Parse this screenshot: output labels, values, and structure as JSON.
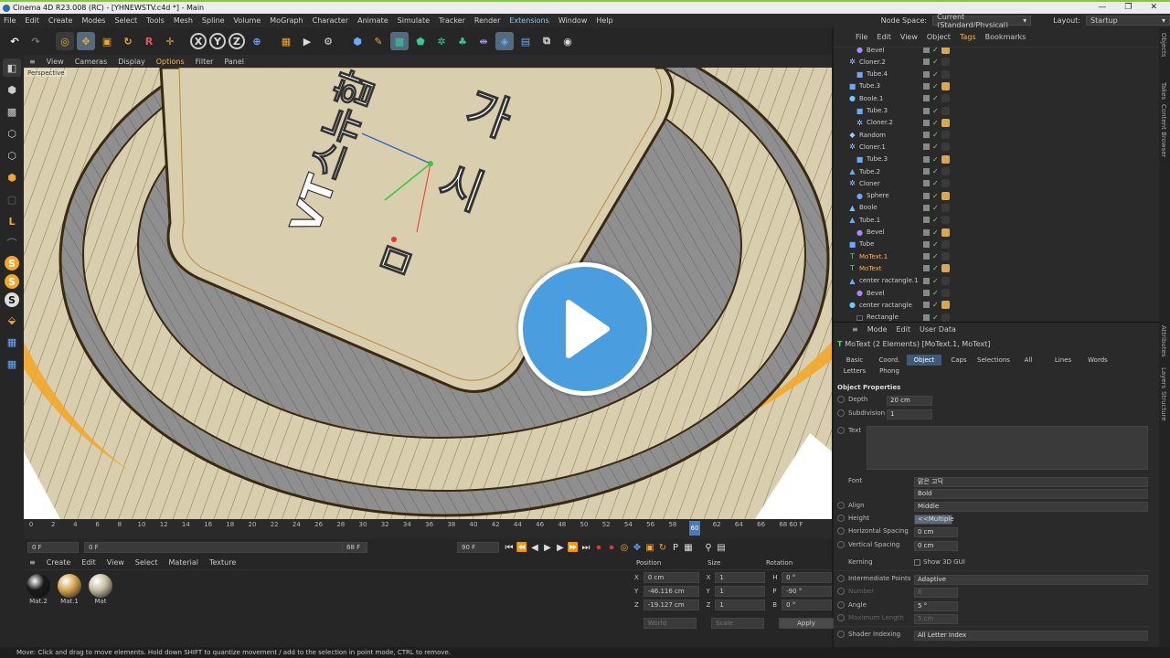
{
  "window": {
    "title": "Cinema 4D R23.008 (RC) - [YHNEWSTV.c4d *] - Main",
    "controls": [
      "—",
      "❐",
      "✕"
    ]
  },
  "menu": [
    "File",
    "Edit",
    "Create",
    "Modes",
    "Select",
    "Tools",
    "Mesh",
    "Spline",
    "Volume",
    "MoGraph",
    "Character",
    "Animate",
    "Simulate",
    "Tracker",
    "Render",
    "Extensions",
    "Window",
    "Help"
  ],
  "header_right": {
    "node_space_label": "Node Space:",
    "node_space_value": "Current (Standard/Physical)",
    "layout_label": "Layout:",
    "layout_value": "Startup"
  },
  "viewport": {
    "menu": [
      "View",
      "Cameras",
      "Display",
      "Options",
      "Filter",
      "Panel"
    ],
    "label": "Perspective"
  },
  "timeline": {
    "ticks": [
      "0",
      "2",
      "4",
      "6",
      "8",
      "10",
      "12",
      "14",
      "16",
      "18",
      "20",
      "22",
      "24",
      "26",
      "28",
      "30",
      "32",
      "34",
      "36",
      "38",
      "40",
      "42",
      "44",
      "46",
      "48",
      "50",
      "52",
      "54",
      "56",
      "58",
      "60",
      "62",
      "64",
      "66",
      "68"
    ],
    "current": "60",
    "end_label": "60 F"
  },
  "transport": {
    "start": "0 F",
    "start2": "0 F",
    "end_field": "68 F",
    "end2": "90 F"
  },
  "materials": {
    "menu": [
      "Create",
      "Edit",
      "View",
      "Select",
      "Material",
      "Texture"
    ],
    "items": [
      {
        "name": "Mat.2",
        "color": "#1a1a1a"
      },
      {
        "name": "Mat.1",
        "color": "#d8a850"
      },
      {
        "name": "Mat",
        "color": "#c8c0a0"
      }
    ]
  },
  "coords": {
    "headers": [
      "Position",
      "Size",
      "Rotation"
    ],
    "rows": [
      {
        "axis": "X",
        "pos": "0 cm",
        "size_axis": "X",
        "size": "1",
        "rot_axis": "H",
        "rot": "0 °"
      },
      {
        "axis": "Y",
        "pos": "-46.116 cm",
        "size_axis": "Y",
        "size": "1",
        "rot_axis": "P",
        "rot": "-90 °"
      },
      {
        "axis": "Z",
        "pos": "-19.127 cm",
        "size_axis": "Z",
        "size": "1",
        "rot_axis": "B",
        "rot": "0 °"
      }
    ],
    "mode1": "World",
    "mode2": "Scale",
    "apply": "Apply"
  },
  "status": "Move: Click and drag to move elements. Hold down SHIFT to quantize movement / add to the selection in point mode, CTRL to remove.",
  "object_manager": {
    "menu": [
      "File",
      "Edit",
      "View",
      "Object",
      "Tags",
      "Bookmarks"
    ],
    "rows": [
      {
        "name": "Bevel",
        "indent": 2,
        "icon": "●",
        "color": "#a8f"
      },
      {
        "name": "Cloner.2",
        "indent": 1,
        "icon": "✲",
        "color": "#9cf"
      },
      {
        "name": "Tube.4",
        "indent": 2,
        "icon": "■",
        "color": "#6af"
      },
      {
        "name": "Tube.3",
        "indent": 1,
        "icon": "■",
        "color": "#6af"
      },
      {
        "name": "Boole.1",
        "indent": 1,
        "icon": "●",
        "color": "#6cf"
      },
      {
        "name": "Tube.3",
        "indent": 2,
        "icon": "■",
        "color": "#6af"
      },
      {
        "name": "Cloner.2",
        "indent": 2,
        "icon": "✲",
        "color": "#9cf"
      },
      {
        "name": "Random",
        "indent": 1,
        "icon": "◆",
        "color": "#9cf"
      },
      {
        "name": "Cloner.1",
        "indent": 1,
        "icon": "✲",
        "color": "#9cf"
      },
      {
        "name": "Tube.3",
        "indent": 2,
        "icon": "■",
        "color": "#6af"
      },
      {
        "name": "Tube.2",
        "indent": 1,
        "icon": "▲",
        "color": "#6af"
      },
      {
        "name": "Cloner",
        "indent": 1,
        "icon": "✲",
        "color": "#9cf"
      },
      {
        "name": "Sphere",
        "indent": 2,
        "icon": "●",
        "color": "#6af"
      },
      {
        "name": "Boole",
        "indent": 1,
        "icon": "▲",
        "color": "#6cf"
      },
      {
        "name": "Tube.1",
        "indent": 1,
        "icon": "▲",
        "color": "#6af"
      },
      {
        "name": "Bevel",
        "indent": 2,
        "icon": "●",
        "color": "#a8f"
      },
      {
        "name": "Tube",
        "indent": 1,
        "icon": "■",
        "color": "#6af"
      },
      {
        "name": "MoText.1",
        "indent": 1,
        "icon": "T",
        "color": "#6c6",
        "sel": true
      },
      {
        "name": "MoText",
        "indent": 1,
        "icon": "T",
        "color": "#6c6",
        "sel": true
      },
      {
        "name": "center ractangle.1",
        "indent": 1,
        "icon": "▲",
        "color": "#6af"
      },
      {
        "name": "Bevel",
        "indent": 2,
        "icon": "●",
        "color": "#a8f"
      },
      {
        "name": "center ractangle",
        "indent": 1,
        "icon": "●",
        "color": "#6cf"
      },
      {
        "name": "Rectangle",
        "indent": 2,
        "icon": "□",
        "color": "#aaa"
      }
    ]
  },
  "attributes": {
    "menu": [
      "Mode",
      "Edit",
      "User Data"
    ],
    "title": "MoText (2 Elements) [MoText.1, MoText]",
    "tabs": [
      "Basic",
      "Coord.",
      "Object",
      "Caps",
      "Selections",
      "All",
      "Lines",
      "Words",
      "Letters",
      "Phong"
    ],
    "active_tab": "Object",
    "section": "Object Properties",
    "depth_label": "Depth",
    "depth": "20 cm",
    "subdiv_label": "Subdivision",
    "subdiv": "1",
    "text_label": "Text",
    "font_label": "Font",
    "font": "맑은 고딕",
    "font_style": "Bold",
    "align_label": "Align",
    "align": "Middle",
    "height_label": "Height",
    "height": "<<Multiple",
    "hspace_label": "Horizontal Spacing",
    "hspace": "0 cm",
    "vspace_label": "Vertical Spacing",
    "vspace": "0 cm",
    "kerning_label": "Kerning",
    "show3d": "Show 3D GUI",
    "interp_label": "Intermediate Points",
    "interp": "Adaptive",
    "number_label": "Number",
    "number": "8",
    "angle_label": "Angle",
    "angle": "5 °",
    "maxlen_label": "Maximum Length",
    "maxlen": "5 cm",
    "shader_label": "Shader Indexing",
    "shader": "All Letter Index"
  },
  "side_tabs": [
    "Objects",
    "Takes",
    "Content Browser",
    "Attributes",
    "Layers",
    "Structure"
  ],
  "viewport_text": {
    "line1": "가",
    "line2": "시",
    "line3": "VT스뉴합",
    "line4": "ㅁ"
  },
  "colors": {
    "orange": "#f5a623",
    "accent": "#4a9ee0",
    "beige": "#d9cfae",
    "gray": "#8c8c8c"
  }
}
